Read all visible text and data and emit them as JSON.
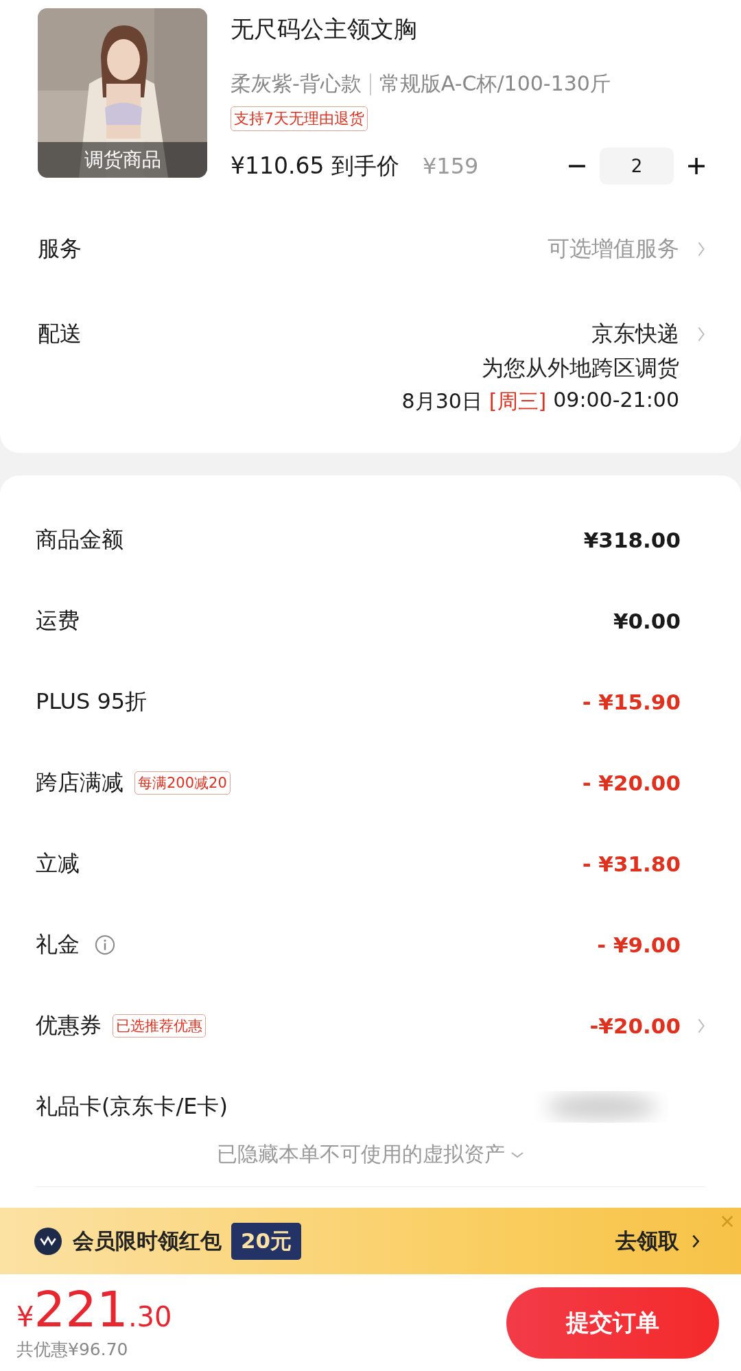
{
  "product": {
    "image_tag": "调货商品",
    "title": "无尺码公主领文胸",
    "spec": [
      "柔灰紫-背心款",
      "常规版A-C杯/100-130斤"
    ],
    "badge": "支持7天无理由退货",
    "price": "¥110.65 到手价",
    "original_price": "¥159",
    "quantity": "2"
  },
  "service": {
    "label": "服务",
    "value": "可选增值服务"
  },
  "delivery": {
    "label": "配送",
    "carrier": "京东快递",
    "note": "为您从外地跨区调货",
    "date": "8月30日",
    "weekday": "[周三]",
    "time": "09:00-21:00"
  },
  "summary": {
    "rows": [
      {
        "label": "商品金额",
        "value": "¥318.00",
        "kind": "amount",
        "info": false,
        "chevron": false
      },
      {
        "label": "运费",
        "value": "¥0.00",
        "kind": "amount",
        "info": false,
        "chevron": false
      },
      {
        "label": "PLUS 95折",
        "value": "- ¥15.90",
        "kind": "discount",
        "info": false,
        "chevron": false
      },
      {
        "label": "跨店满减",
        "tag": "每满200减20",
        "value": "- ¥20.00",
        "kind": "discount",
        "info": false,
        "chevron": false
      },
      {
        "label": "立减",
        "value": "- ¥31.80",
        "kind": "discount",
        "info": false,
        "chevron": false
      },
      {
        "label": "礼金",
        "value": "- ¥9.00",
        "kind": "discount",
        "info": true,
        "chevron": false
      },
      {
        "label": "优惠券",
        "tag": "已选推荐优惠",
        "value": "-¥20.00",
        "kind": "discount",
        "info": false,
        "chevron": true
      },
      {
        "label": "礼品卡(京东卡/E卡)",
        "kind": "blurred",
        "info": false,
        "chevron": false
      }
    ],
    "hidden_note": "已隐藏本单不可使用的虚拟资产"
  },
  "banner": {
    "text": "会员限时领红包",
    "amount": "20元",
    "action": "去领取"
  },
  "footer": {
    "currency": "¥",
    "total_int": "221",
    "total_dec": ".30",
    "savings": "共优惠¥96.70",
    "submit": "提交订单"
  }
}
